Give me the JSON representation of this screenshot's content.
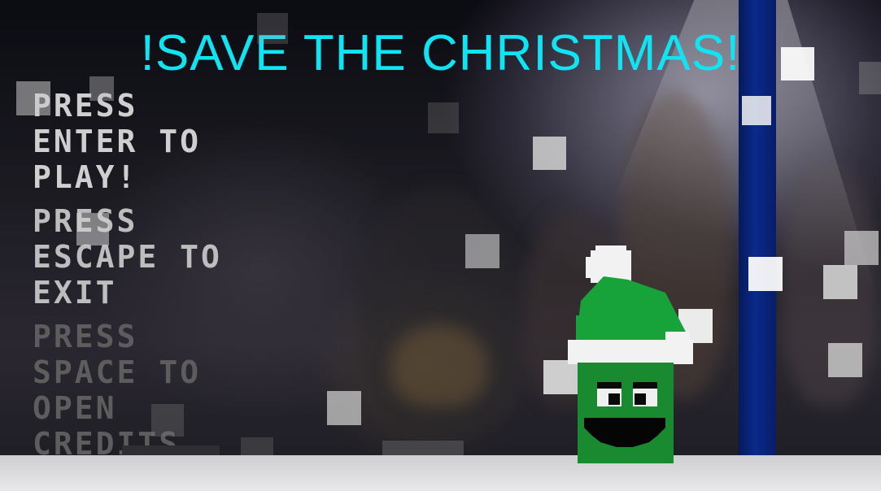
{
  "title": "!SAVE THE CHRISTMAS!",
  "menu": {
    "play": "PRESS ENTER TO PLAY!",
    "exit": "PRESS ESCAPE TO EXIT",
    "credits": "PRESS SPACE TO OPEN CREDITS"
  },
  "colors": {
    "title": "#10e4f2",
    "pole": "#0a2a8a",
    "hat": "#17a33a",
    "body": "#1a8a30",
    "snow": "#e0e0e0"
  }
}
